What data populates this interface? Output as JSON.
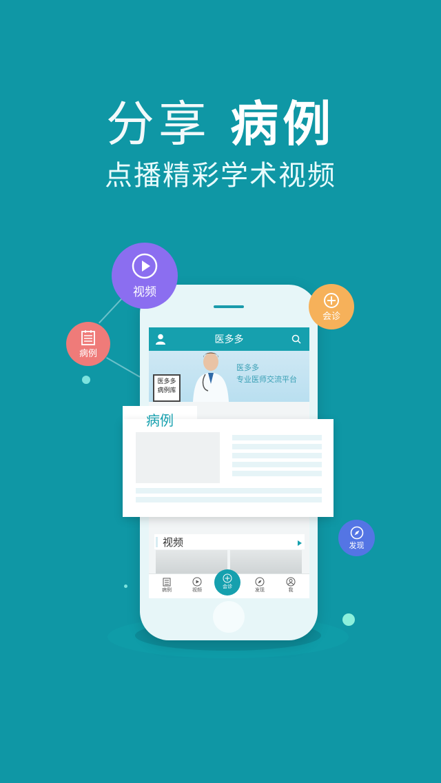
{
  "hero": {
    "title_light": "分享",
    "title_bold": "病例",
    "subtitle": "点播精彩学术视频"
  },
  "bubbles": {
    "video": "视频",
    "cases": "病例",
    "consult": "会诊",
    "discover": "发现"
  },
  "app": {
    "title": "医多多",
    "banner_sign": "医多多 病例库",
    "banner_slogan_top": "医多多",
    "banner_slogan": "专业医师交流平台"
  },
  "card": {
    "title": "病例"
  },
  "video_section": {
    "title": "视频"
  },
  "tabbar": {
    "items": [
      {
        "label": "病例",
        "icon": "notebook-icon"
      },
      {
        "label": "视频",
        "icon": "play-icon"
      },
      {
        "label": "会诊",
        "icon": "consult-icon"
      },
      {
        "label": "发现",
        "icon": "compass-icon"
      },
      {
        "label": "我",
        "icon": "user-icon"
      }
    ]
  },
  "colors": {
    "background": "#0f97a5",
    "accent": "#16a0ae",
    "video_bubble": "#8b6ef0",
    "cases_bubble": "#ef7b79",
    "consult_bubble": "#f6b15a",
    "discover_bubble": "#5475e4"
  }
}
